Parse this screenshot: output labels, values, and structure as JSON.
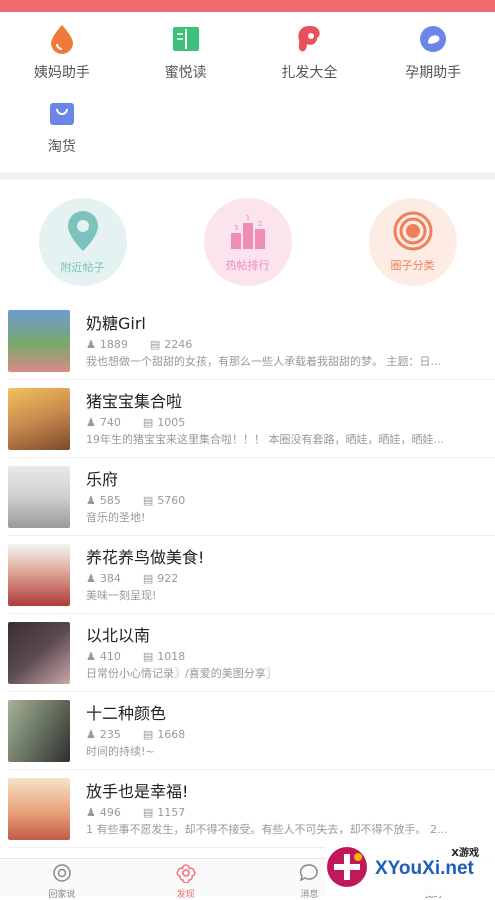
{
  "header": {
    "color": "#f2696e"
  },
  "apps": [
    {
      "label": "姨妈助手",
      "icon": "drop-icon",
      "color": "#f07a3c"
    },
    {
      "label": "蜜悦读",
      "icon": "book-icon",
      "color": "#3cc07a"
    },
    {
      "label": "扎发大全",
      "icon": "hair-icon",
      "color": "#e8505b"
    },
    {
      "label": "孕期助手",
      "icon": "pregnancy-icon",
      "color": "#6b86e8"
    },
    {
      "label": "淘货",
      "icon": "shopping-bag-icon",
      "color": "#6b86e8"
    }
  ],
  "features": [
    {
      "label": "附近帖子",
      "icon": "location-pin-icon",
      "bg": "#e4f3f1",
      "color": "#7cc2bd"
    },
    {
      "label": "热帖排行",
      "icon": "ranking-icon",
      "bg": "#fbe4ee",
      "color": "#f18cb4"
    },
    {
      "label": "圈子分类",
      "icon": "target-icon",
      "bg": "#fdece4",
      "color": "#f0805a"
    }
  ],
  "circles": [
    {
      "name": "奶糖Girl",
      "members": "1889",
      "posts": "2246",
      "desc": "我也想做一个甜甜的女孩，有那么一些人承载着我甜甜的梦。 主题：日...",
      "thumb": "#7aa86a"
    },
    {
      "name": "猪宝宝集合啦",
      "members": "740",
      "posts": "1005",
      "desc": "19年生的猪宝宝来这里集合啦！！！  本圈没有套路，晒娃，晒娃，晒娃...",
      "thumb": "#c9894f"
    },
    {
      "name": "乐府",
      "members": "585",
      "posts": "5760",
      "desc": "音乐的圣地!",
      "thumb": "#cfcfcf"
    },
    {
      "name": "养花养鸟做美食!",
      "members": "384",
      "posts": "922",
      "desc": "美味一刻呈现!",
      "thumb": "#b03a3a"
    },
    {
      "name": "以北以南",
      "members": "410",
      "posts": "1018",
      "desc": "日常份小心情记录〗/喜爱的美图分享〗",
      "thumb": "#5b4a52"
    },
    {
      "name": "十二种颜色",
      "members": "235",
      "posts": "1668",
      "desc": "时间的持续!~",
      "thumb": "#6e7a66"
    },
    {
      "name": "放手也是幸福!",
      "members": "496",
      "posts": "1157",
      "desc": "1 有些事不愿发生，却不得不接受。有些人不可失去，却不得不放手。 2...",
      "thumb": "#e8a27a"
    }
  ],
  "tabs": [
    {
      "label": "回家说",
      "icon": "home-swirl-icon",
      "active": false
    },
    {
      "label": "发现",
      "icon": "flower-icon",
      "active": true
    },
    {
      "label": "消息",
      "icon": "message-icon",
      "active": false
    },
    {
      "label": "我的",
      "icon": "user-icon",
      "active": false
    }
  ],
  "watermark": {
    "text": "XYouXi.net",
    "small": "X游戏"
  }
}
